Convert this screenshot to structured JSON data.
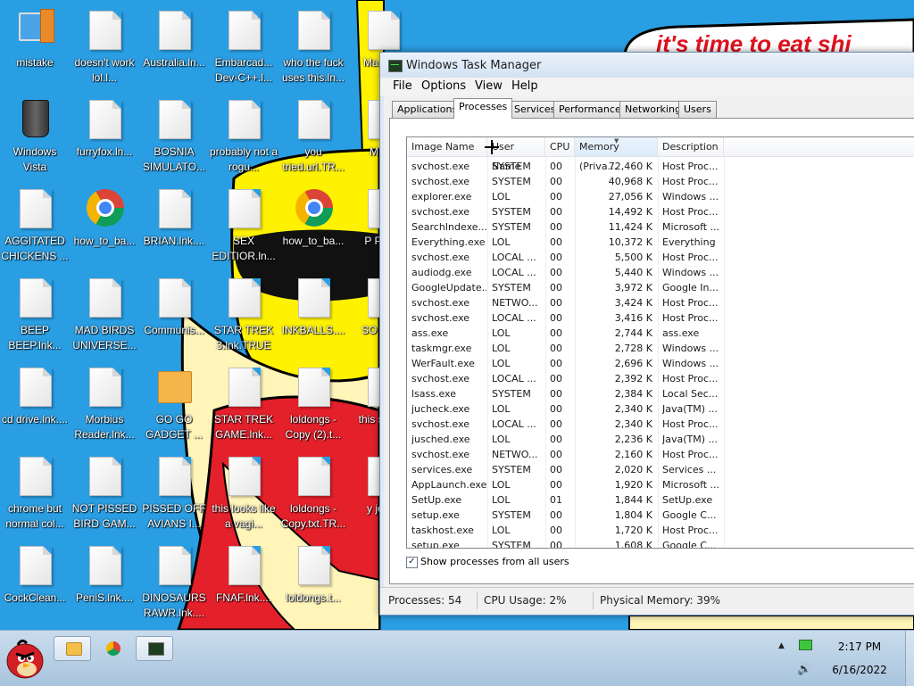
{
  "wallpaper": {
    "banner_text": "it's time to eat shi"
  },
  "desktop_icons": [
    {
      "label": "mistake",
      "kind": "pc"
    },
    {
      "label": "doesn't work lol.l...",
      "kind": "doc"
    },
    {
      "label": "Australia.ln...",
      "kind": "doc"
    },
    {
      "label": "Embarcad... Dev-C++.l...",
      "kind": "doc"
    },
    {
      "label": "who the fuck uses this.ln...",
      "kind": "doc"
    },
    {
      "label": "Ma Byte",
      "kind": "doc"
    },
    {
      "label": "Windows Vista",
      "kind": "bin"
    },
    {
      "label": "furryfox.ln...",
      "kind": "doc"
    },
    {
      "label": "BOSNIA SIMULATO...",
      "kind": "doc"
    },
    {
      "label": "probably not a rogu...",
      "kind": "doc"
    },
    {
      "label": "you tried.url.TR...",
      "kind": "doc"
    },
    {
      "label": "MINE",
      "kind": "doc"
    },
    {
      "label": "AGGITATED CHICKENS ...",
      "kind": "doc"
    },
    {
      "label": "how_to_ba...",
      "kind": "chrome"
    },
    {
      "label": "BRIAN.lnk....",
      "kind": "doc"
    },
    {
      "label": "SEX EDITIOR.ln...",
      "kind": "doc"
    },
    {
      "label": "how_to_ba...",
      "kind": "chrome"
    },
    {
      "label": "P Playe",
      "kind": "doc"
    },
    {
      "label": "BEEP BEEP.lnk...",
      "kind": "doc"
    },
    {
      "label": "MAD BIRDS UNIVERSE...",
      "kind": "doc"
    },
    {
      "label": "Communis...",
      "kind": "doc"
    },
    {
      "label": "STAR TREK 3.lnk.TRUE",
      "kind": "doc"
    },
    {
      "label": "INKBALLS....",
      "kind": "doc"
    },
    {
      "label": "SO AIRE",
      "kind": "doc"
    },
    {
      "label": "cd drive.lnk....",
      "kind": "doc"
    },
    {
      "label": "Morbius Reader.lnk...",
      "kind": "doc"
    },
    {
      "label": "GO GO GADGET ...",
      "kind": "folder"
    },
    {
      "label": "STAR TREK GAME.lnk...",
      "kind": "doc"
    },
    {
      "label": "loldongs - Copy (2).t...",
      "kind": "doc"
    },
    {
      "label": "this s be o",
      "kind": "doc"
    },
    {
      "label": "chrome but normal col...",
      "kind": "doc"
    },
    {
      "label": "NOT PISSED BIRD GAM...",
      "kind": "doc"
    },
    {
      "label": "PISSED OFF AVIANS I...",
      "kind": "doc"
    },
    {
      "label": "this looks like a vagi...",
      "kind": "doc"
    },
    {
      "label": "loldongs - Copy.txt.TR...",
      "kind": "doc"
    },
    {
      "label": "y journ",
      "kind": "doc"
    },
    {
      "label": "CockClean...",
      "kind": "doc"
    },
    {
      "label": "PeniS.lnk....",
      "kind": "doc"
    },
    {
      "label": "DINOSAURS RAWR.lnk....",
      "kind": "doc"
    },
    {
      "label": "FNAF.lnk....",
      "kind": "doc"
    },
    {
      "label": "loldongs.t...",
      "kind": "doc"
    }
  ],
  "task_manager": {
    "title": "Windows Task Manager",
    "menu": [
      "File",
      "Options",
      "View",
      "Help"
    ],
    "tabs": [
      "Applications",
      "Processes",
      "Services",
      "Performance",
      "Networking",
      "Users"
    ],
    "active_tab": "Processes",
    "columns": [
      "Image Name",
      "User Name",
      "CPU",
      "Memory (Priva...",
      "Description"
    ],
    "sorted_column": "Memory (Priva...",
    "processes": [
      [
        "svchost.exe",
        "SYSTEM",
        "00",
        "72,460 K",
        "Host Proc..."
      ],
      [
        "svchost.exe",
        "SYSTEM",
        "00",
        "40,968 K",
        "Host Proc..."
      ],
      [
        "explorer.exe",
        "LOL",
        "00",
        "27,056 K",
        "Windows ..."
      ],
      [
        "svchost.exe",
        "SYSTEM",
        "00",
        "14,492 K",
        "Host Proc..."
      ],
      [
        "SearchIndexe...",
        "SYSTEM",
        "00",
        "11,424 K",
        "Microsoft ..."
      ],
      [
        "Everything.exe",
        "LOL",
        "00",
        "10,372 K",
        "Everything"
      ],
      [
        "svchost.exe",
        "LOCAL ...",
        "00",
        "5,500 K",
        "Host Proc..."
      ],
      [
        "audiodg.exe",
        "LOCAL ...",
        "00",
        "5,440 K",
        "Windows ..."
      ],
      [
        "GoogleUpdate....",
        "SYSTEM",
        "00",
        "3,972 K",
        "Google In..."
      ],
      [
        "svchost.exe",
        "NETWO...",
        "00",
        "3,424 K",
        "Host Proc..."
      ],
      [
        "svchost.exe",
        "LOCAL ...",
        "00",
        "3,416 K",
        "Host Proc..."
      ],
      [
        "ass.exe",
        "LOL",
        "00",
        "2,744 K",
        "ass.exe"
      ],
      [
        "taskmgr.exe",
        "LOL",
        "00",
        "2,728 K",
        "Windows ..."
      ],
      [
        "WerFault.exe",
        "LOL",
        "00",
        "2,696 K",
        "Windows ..."
      ],
      [
        "svchost.exe",
        "LOCAL ...",
        "00",
        "2,392 K",
        "Host Proc..."
      ],
      [
        "lsass.exe",
        "SYSTEM",
        "00",
        "2,384 K",
        "Local Sec..."
      ],
      [
        "jucheck.exe",
        "LOL",
        "00",
        "2,340 K",
        "Java(TM) ..."
      ],
      [
        "svchost.exe",
        "LOCAL ...",
        "00",
        "2,340 K",
        "Host Proc..."
      ],
      [
        "jusched.exe",
        "LOL",
        "00",
        "2,236 K",
        "Java(TM) ..."
      ],
      [
        "svchost.exe",
        "NETWO...",
        "00",
        "2,160 K",
        "Host Proc..."
      ],
      [
        "services.exe",
        "SYSTEM",
        "00",
        "2,020 K",
        "Services ..."
      ],
      [
        "AppLaunch.exe",
        "LOL",
        "00",
        "1,920 K",
        "Microsoft ..."
      ],
      [
        "SetUp.exe",
        "LOL",
        "01",
        "1,844 K",
        "SetUp.exe"
      ],
      [
        "setup.exe",
        "SYSTEM",
        "00",
        "1,804 K",
        "Google C..."
      ],
      [
        "taskhost.exe",
        "LOL",
        "00",
        "1,720 K",
        "Host Proc..."
      ],
      [
        "setup.exe",
        "SYSTEM",
        "00",
        "1,608 K",
        "Google C..."
      ]
    ],
    "show_all_label": "Show processes from all users",
    "show_all_checked": "✓",
    "status": {
      "processes": "Processes: 54",
      "cpu": "CPU Usage: 2%",
      "memory": "Physical Memory: 39%"
    }
  },
  "taskbar": {
    "time": "2:17 PM",
    "date": "6/16/2022"
  }
}
